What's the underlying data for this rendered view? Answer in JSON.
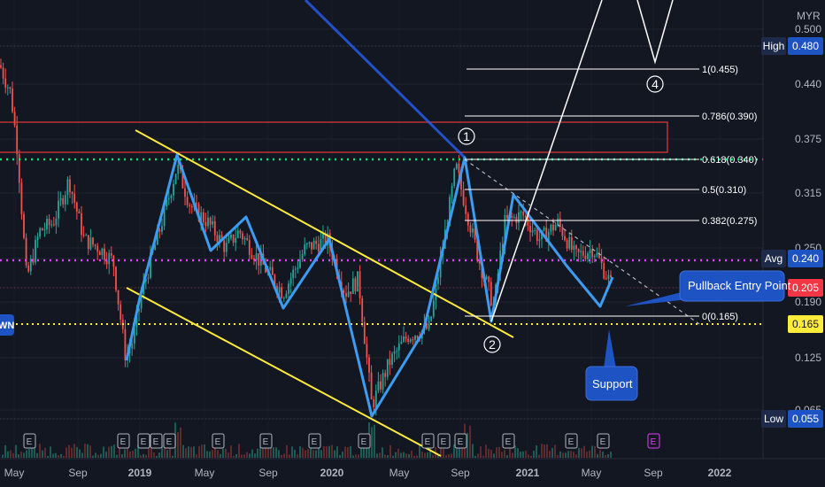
{
  "chart_data": {
    "type": "line",
    "currency": "MYR",
    "y_ticks": [
      "0.500",
      "0.480",
      "0.440",
      "0.375",
      "0.315",
      "0.250",
      "0.240",
      "0.205",
      "0.190",
      "0.165",
      "0.125",
      "0.065",
      "0.055"
    ],
    "x_ticks": [
      "May",
      "Sep",
      "2019",
      "May",
      "Sep",
      "2020",
      "May",
      "Sep",
      "2021",
      "May",
      "Sep",
      "2022"
    ],
    "price_tags": [
      {
        "label": "High",
        "value": "0.480"
      },
      {
        "label": "Avg",
        "value": "0.240"
      },
      {
        "label": "",
        "value": "0.205",
        "color": "#f23645"
      },
      {
        "label": "",
        "value": "0.165",
        "color": "#ffeb3b"
      },
      {
        "label": "Low",
        "value": "0.055"
      }
    ],
    "fib_levels": [
      {
        "label": "1(0.455)",
        "value": 0.455
      },
      {
        "label": "0.786(0.390)",
        "value": 0.39
      },
      {
        "label": "0.618(0.340)",
        "value": 0.34
      },
      {
        "label": "0.5(0.310)",
        "value": 0.31
      },
      {
        "label": "0.382(0.275)",
        "value": 0.275
      },
      {
        "label": "0(0.165)",
        "value": 0.165
      }
    ],
    "wave_labels": [
      "1",
      "2",
      "4"
    ],
    "left_tag": "WN",
    "annotations": {
      "pullback": "Pullback Entry Point",
      "support": "Support"
    },
    "earnings_marker": "E",
    "colors": {
      "background": "#131722",
      "up": "#26a69a",
      "down": "#ef5350",
      "wave": "#3d9bf0",
      "channel": "#ffeb3b",
      "fib": "#ffffff",
      "resistance": "#e53935",
      "green_dotted": "#00e676",
      "pink_dotted": "#e040fb",
      "callout": "#1e53c4"
    }
  }
}
